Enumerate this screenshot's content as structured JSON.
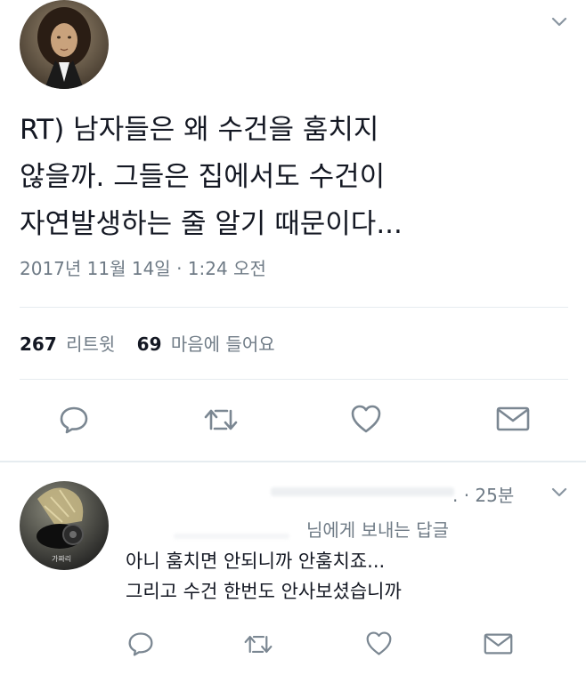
{
  "tweet": {
    "text_lines": [
      "RT) 남자들은 왜 수건을 훔치지",
      "않을까. 그들은 집에서도 수건이",
      "자연발생하는 줄 알기 때문이다..."
    ],
    "timestamp": "2017년 11월 14일 · 1:24 오전",
    "retweet_count": "267",
    "retweet_label": "리트윗",
    "like_count": "69",
    "like_label": "마음에 들어요"
  },
  "reply": {
    "time": ". · 25분",
    "reply_to": "님에게 보내는 답글",
    "avatar_caption": "가짜리",
    "text_lines": [
      "아니 훔치면 안되니까 안훔치죠...",
      "그리고 수건 한번도 안사보셨습니까"
    ]
  },
  "icons": [
    "chevron-down-icon",
    "reply-icon",
    "retweet-icon",
    "like-icon",
    "message-icon"
  ],
  "colors": {
    "text": "#141823",
    "muted": "#6f7b86",
    "icon": "#7b8792",
    "separator": "#e6ecf0"
  }
}
